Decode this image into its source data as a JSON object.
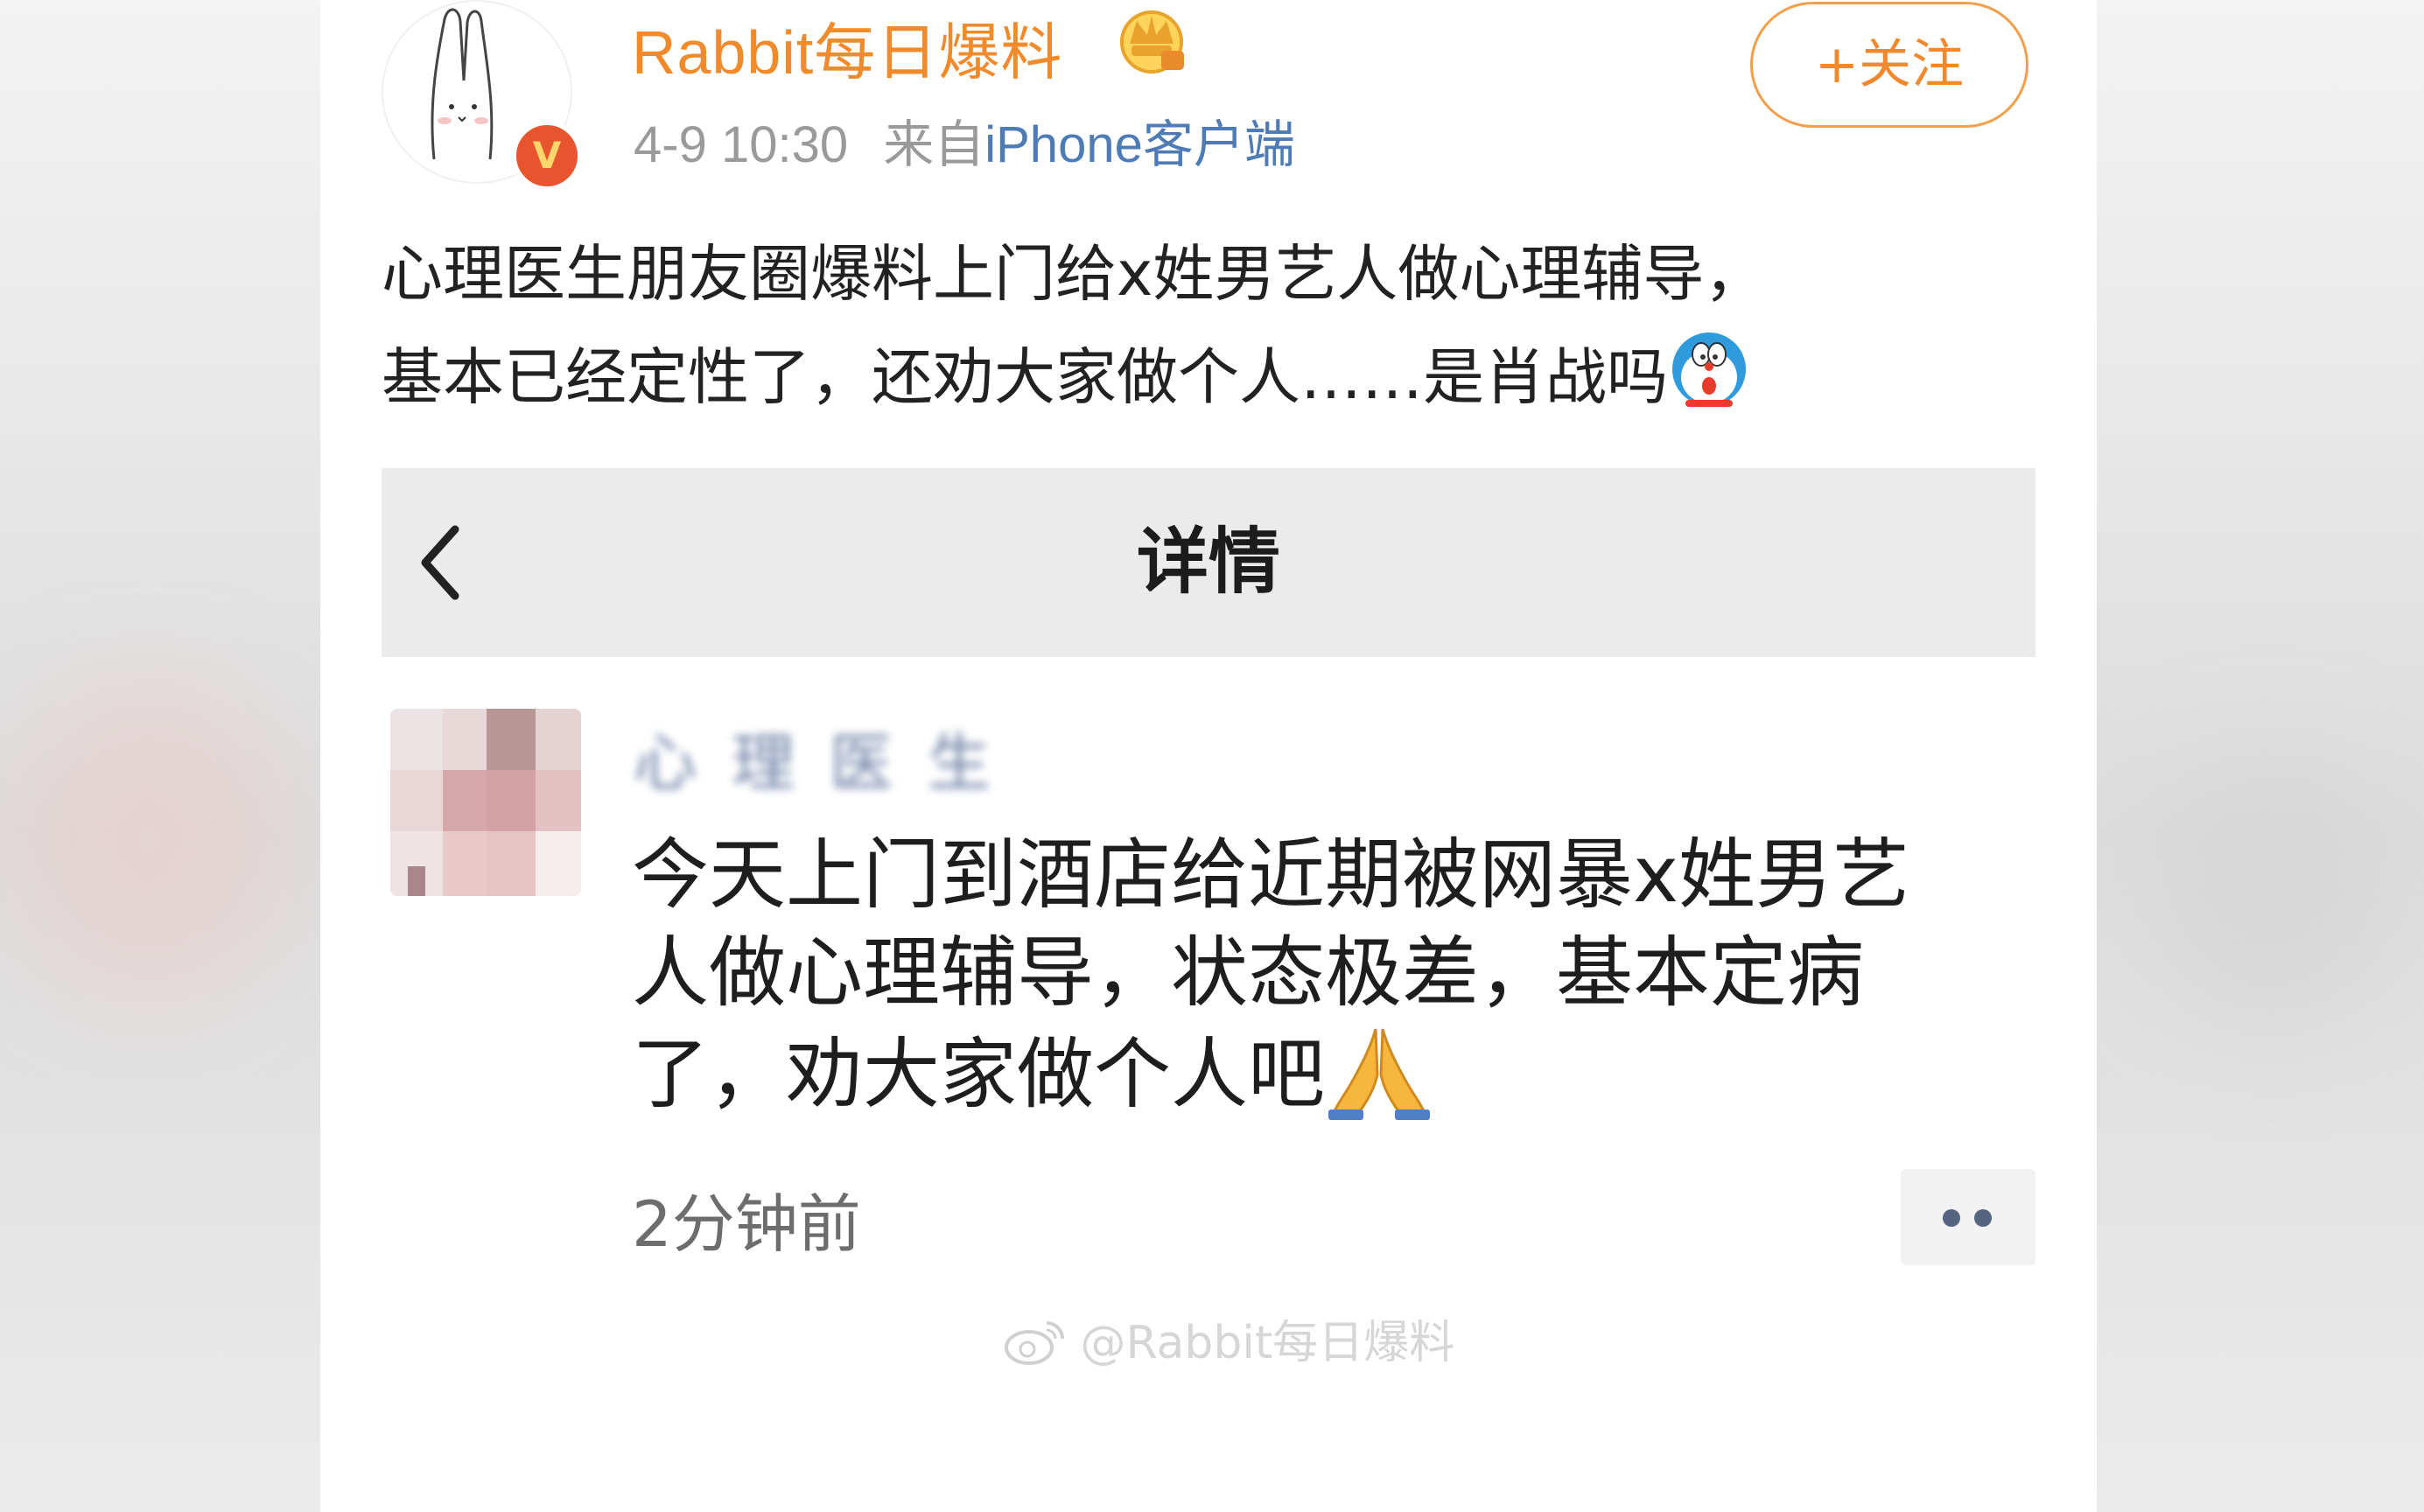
{
  "post": {
    "username": "Rabbit每日爆料",
    "time": "4-9 10:30",
    "source_prefix": "来自",
    "source_name": "iPhone客户端",
    "follow_label": "+关注",
    "text_line1": "心理医生朋友圈爆料上门给x姓男艺人做心理辅导，",
    "text_line2": "基本已经定性了，还劝大家做个人……是肖战吗",
    "badge": "V"
  },
  "detail": {
    "title": "详情",
    "author": "心理医生",
    "text_line1": "今天上门到酒店给近期被网暴x姓男艺",
    "text_line2": "人做心理辅导，状态极差，基本定病",
    "text_line3": "了，劝大家做个人吧",
    "time": "2分钟前"
  },
  "watermark": "@Rabbit每日爆料",
  "colors": {
    "username": "#f08a2a",
    "link": "#4f7bb4",
    "meta": "#9a9a9a",
    "badge": "#e8542d"
  },
  "icons": [
    "crown-icon",
    "doraemon-icon",
    "back-icon",
    "pray-icon",
    "more-icon",
    "weibo-icon"
  ]
}
